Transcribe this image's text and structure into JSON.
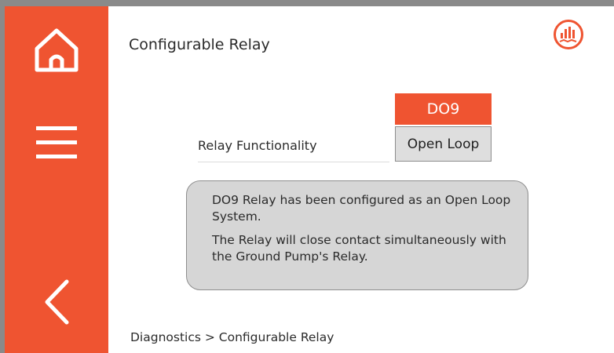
{
  "header": {
    "title": "Configurable Relay",
    "logo_icon": "pump-chart-logo-icon"
  },
  "sidebar": {
    "home_icon": "home-icon",
    "menu_icon": "hamburger-menu-icon",
    "back_icon": "chevron-left-icon"
  },
  "relay": {
    "output_name": "DO9",
    "field_label": "Relay Functionality",
    "value": "Open Loop"
  },
  "info": {
    "line1": "DO9 Relay has been configured as an Open Loop System.",
    "line2": "The Relay will close contact simultaneously with the Ground Pump's Relay."
  },
  "breadcrumb": "Diagnostics > Configurable Relay",
  "colors": {
    "accent": "#ef5431",
    "panel_gray": "#d6d6d6",
    "frame_gray": "#8a8a8a"
  }
}
